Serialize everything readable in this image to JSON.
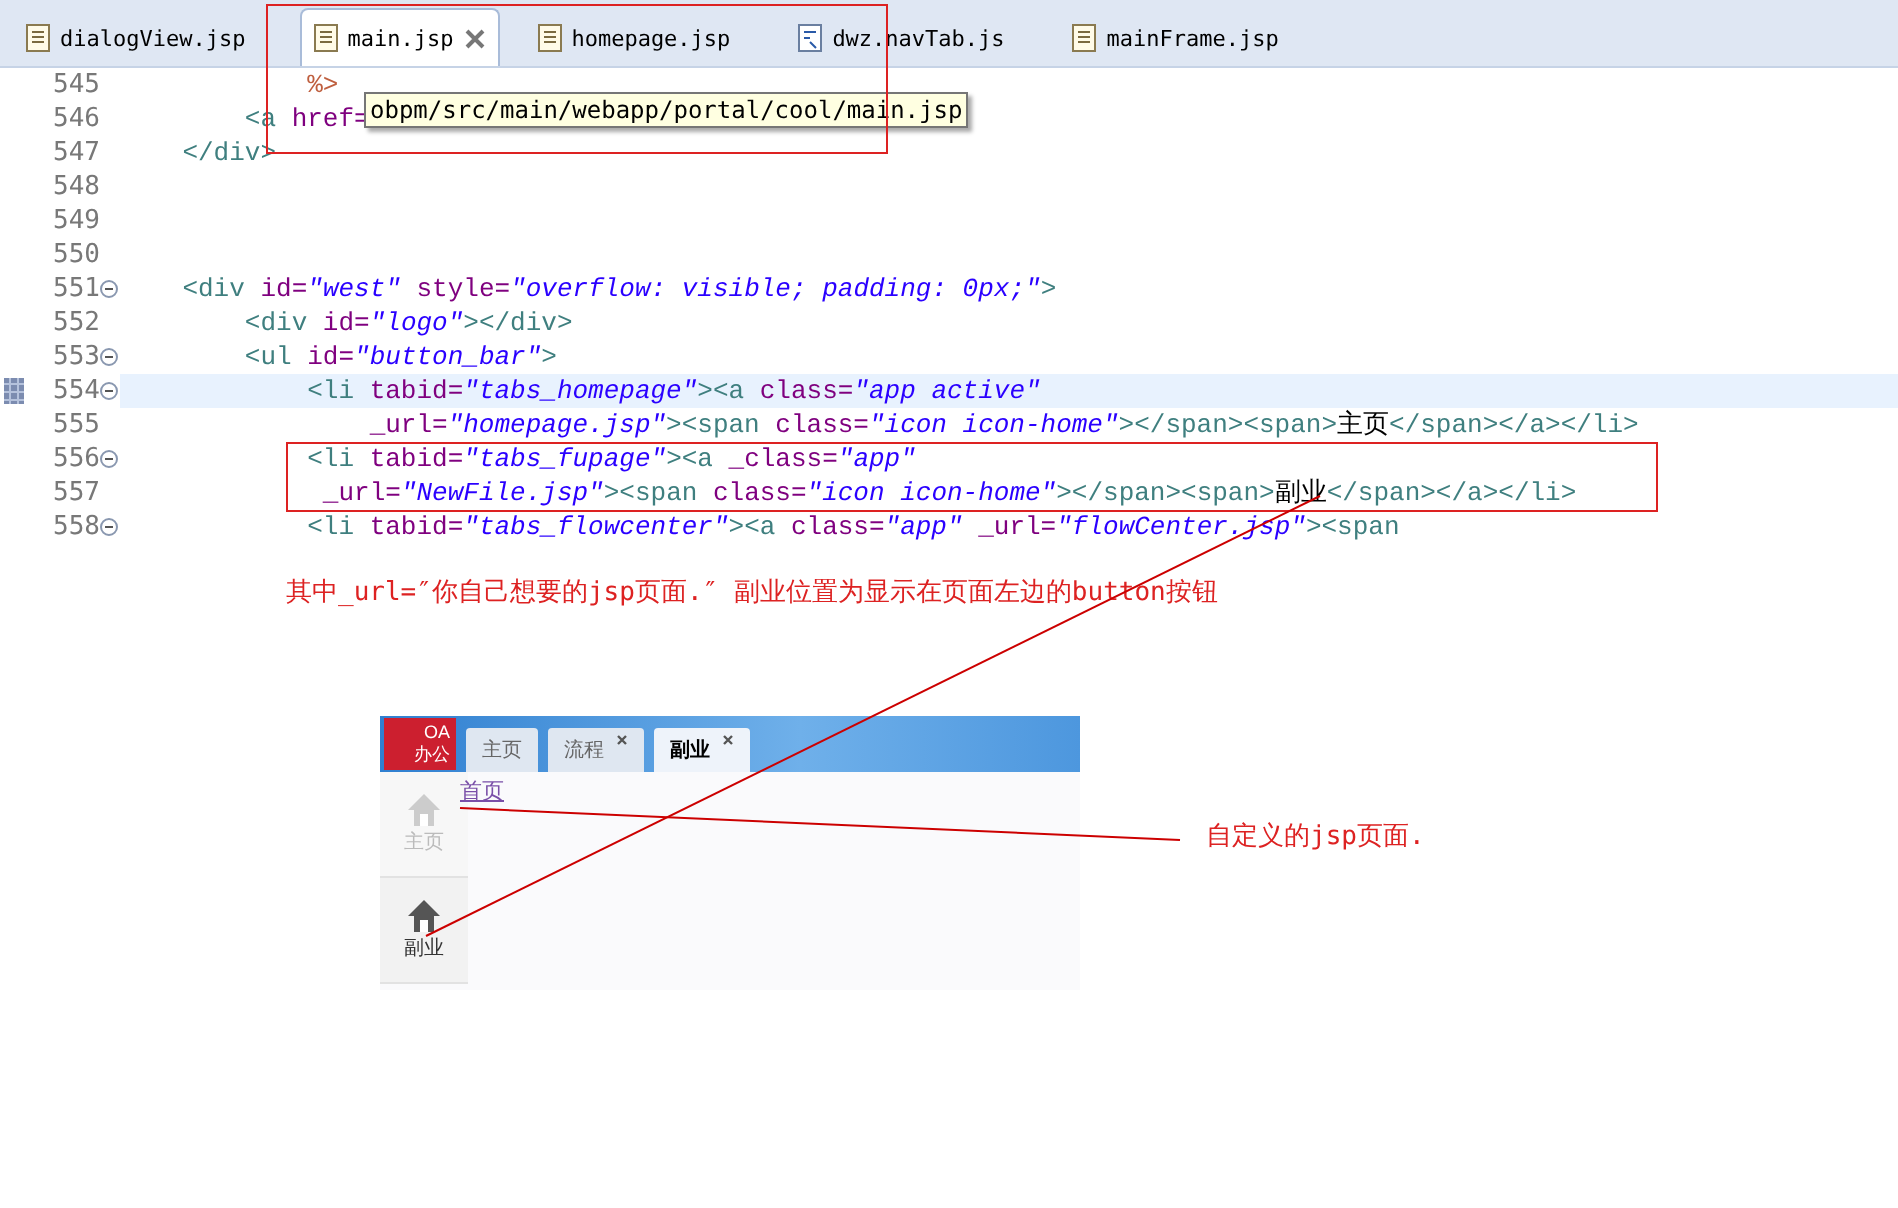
{
  "editor_tabs": [
    {
      "label": "dialogView.jsp",
      "kind": "page",
      "selected": false,
      "closable": false
    },
    {
      "label": "main.jsp",
      "kind": "page",
      "selected": true,
      "closable": true
    },
    {
      "label": "homepage.jsp",
      "kind": "page",
      "selected": false,
      "closable": false
    },
    {
      "label": "dwz.navTab.js",
      "kind": "script",
      "selected": false,
      "closable": false
    },
    {
      "label": "mainFrame.jsp",
      "kind": "page",
      "selected": false,
      "closable": false
    }
  ],
  "code_lines": [
    {
      "number": "545",
      "current": false,
      "foldable": false,
      "bookmark": false,
      "tokens": [
        {
          "kind": "jsp",
          "text": "            %>"
        }
      ]
    },
    {
      "number": "546",
      "current": false,
      "foldable": false,
      "bookmark": false,
      "tokens": [
        {
          "kind": "tag",
          "text": "        <a"
        },
        {
          "kind": "attr",
          "text": " href="
        }
      ]
    },
    {
      "number": "547",
      "current": false,
      "foldable": false,
      "bookmark": false,
      "tokens": [
        {
          "kind": "tag",
          "text": "    </div>"
        }
      ]
    },
    {
      "number": "548",
      "current": false,
      "foldable": false,
      "bookmark": false
    },
    {
      "number": "549",
      "current": false,
      "foldable": false,
      "bookmark": false
    },
    {
      "number": "550",
      "current": false,
      "foldable": false,
      "bookmark": false
    },
    {
      "number": "551",
      "current": false,
      "foldable": true,
      "bookmark": false,
      "tokens": [
        {
          "kind": "tag",
          "text": "    <div"
        },
        {
          "kind": "attr",
          "text": " id="
        },
        {
          "kind": "string",
          "text": "\"west\""
        },
        {
          "kind": "attr",
          "text": " style="
        },
        {
          "kind": "string",
          "text": "\"overflow: visible; padding: 0px;\""
        },
        {
          "kind": "tag",
          "text": ">"
        }
      ]
    },
    {
      "number": "552",
      "current": false,
      "foldable": false,
      "bookmark": false,
      "tokens": [
        {
          "kind": "tag",
          "text": "        <div"
        },
        {
          "kind": "attr",
          "text": " id="
        },
        {
          "kind": "string",
          "text": "\"logo\""
        },
        {
          "kind": "tag",
          "text": "></div>"
        }
      ]
    },
    {
      "number": "553",
      "current": false,
      "foldable": true,
      "bookmark": false,
      "tokens": [
        {
          "kind": "tag",
          "text": "        <ul"
        },
        {
          "kind": "attr",
          "text": " id="
        },
        {
          "kind": "string",
          "text": "\"button_bar\""
        },
        {
          "kind": "tag",
          "text": ">"
        }
      ]
    },
    {
      "number": "554",
      "current": true,
      "foldable": true,
      "bookmark": true,
      "tokens": [
        {
          "kind": "tag",
          "text": "            <li"
        },
        {
          "kind": "attr",
          "text": " tabid="
        },
        {
          "kind": "string",
          "text": "\"tabs_homepage\""
        },
        {
          "kind": "tag",
          "text": "><a"
        },
        {
          "kind": "attr",
          "text": " class="
        },
        {
          "kind": "string",
          "text": "\"app active\""
        }
      ]
    },
    {
      "number": "555",
      "current": false,
      "foldable": false,
      "bookmark": false,
      "tokens": [
        {
          "kind": "attr",
          "text": "                _url="
        },
        {
          "kind": "string",
          "text": "\"homepage.jsp\""
        },
        {
          "kind": "tag",
          "text": "><span"
        },
        {
          "kind": "attr",
          "text": " class="
        },
        {
          "kind": "string",
          "text": "\"icon icon-home\""
        },
        {
          "kind": "tag",
          "text": "></span><span>"
        },
        {
          "kind": "text",
          "text": "主页"
        },
        {
          "kind": "tag",
          "text": "</span></a></li>"
        }
      ]
    },
    {
      "number": "556",
      "current": false,
      "foldable": true,
      "bookmark": false,
      "tokens": [
        {
          "kind": "tag",
          "text": "            <li"
        },
        {
          "kind": "attr",
          "text": " tabid="
        },
        {
          "kind": "string",
          "text": "\"tabs_fupage\""
        },
        {
          "kind": "tag",
          "text": "><a"
        },
        {
          "kind": "attr",
          "text": " _class="
        },
        {
          "kind": "string",
          "text": "\"app\""
        }
      ]
    },
    {
      "number": "557",
      "current": false,
      "foldable": false,
      "bookmark": false,
      "tokens": [
        {
          "kind": "attr",
          "text": "             _url="
        },
        {
          "kind": "string",
          "text": "\"NewFile.jsp\""
        },
        {
          "kind": "tag",
          "text": "><span"
        },
        {
          "kind": "attr",
          "text": " class="
        },
        {
          "kind": "string",
          "text": "\"icon icon-home\""
        },
        {
          "kind": "tag",
          "text": "></span><span>"
        },
        {
          "kind": "text",
          "text": "副业"
        },
        {
          "kind": "tag",
          "text": "</span></a></li>"
        }
      ]
    },
    {
      "number": "558",
      "current": false,
      "foldable": true,
      "bookmark": false,
      "tokens": [
        {
          "kind": "tag",
          "text": "            <li"
        },
        {
          "kind": "attr",
          "text": " tabid="
        },
        {
          "kind": "string",
          "text": "\"tabs_flowcenter\""
        },
        {
          "kind": "tag",
          "text": "><a"
        },
        {
          "kind": "attr",
          "text": " class="
        },
        {
          "kind": "string",
          "text": "\"app\""
        },
        {
          "kind": "attr",
          "text": " _url="
        },
        {
          "kind": "string",
          "text": "\"flowCenter.jsp\""
        },
        {
          "kind": "tag",
          "text": "><span"
        }
      ]
    }
  ],
  "tooltip": "obpm/src/main/webapp/portal/cool/main.jsp",
  "note": "其中_url=″你自己想要的jsp页面.″ 副业位置为显示在页面左边的button按钮",
  "preview": {
    "logo": [
      "OA",
      "办公"
    ],
    "tabs": [
      {
        "label": "主页",
        "selected": false,
        "closable": false
      },
      {
        "label": "流程",
        "selected": false,
        "closable": true
      },
      {
        "label": "副业",
        "selected": true,
        "closable": true
      }
    ],
    "link": "首页",
    "sidebar": [
      {
        "label": "主页",
        "selected": false
      },
      {
        "label": "副业",
        "selected": true
      }
    ]
  },
  "callout": "自定义的jsp页面."
}
